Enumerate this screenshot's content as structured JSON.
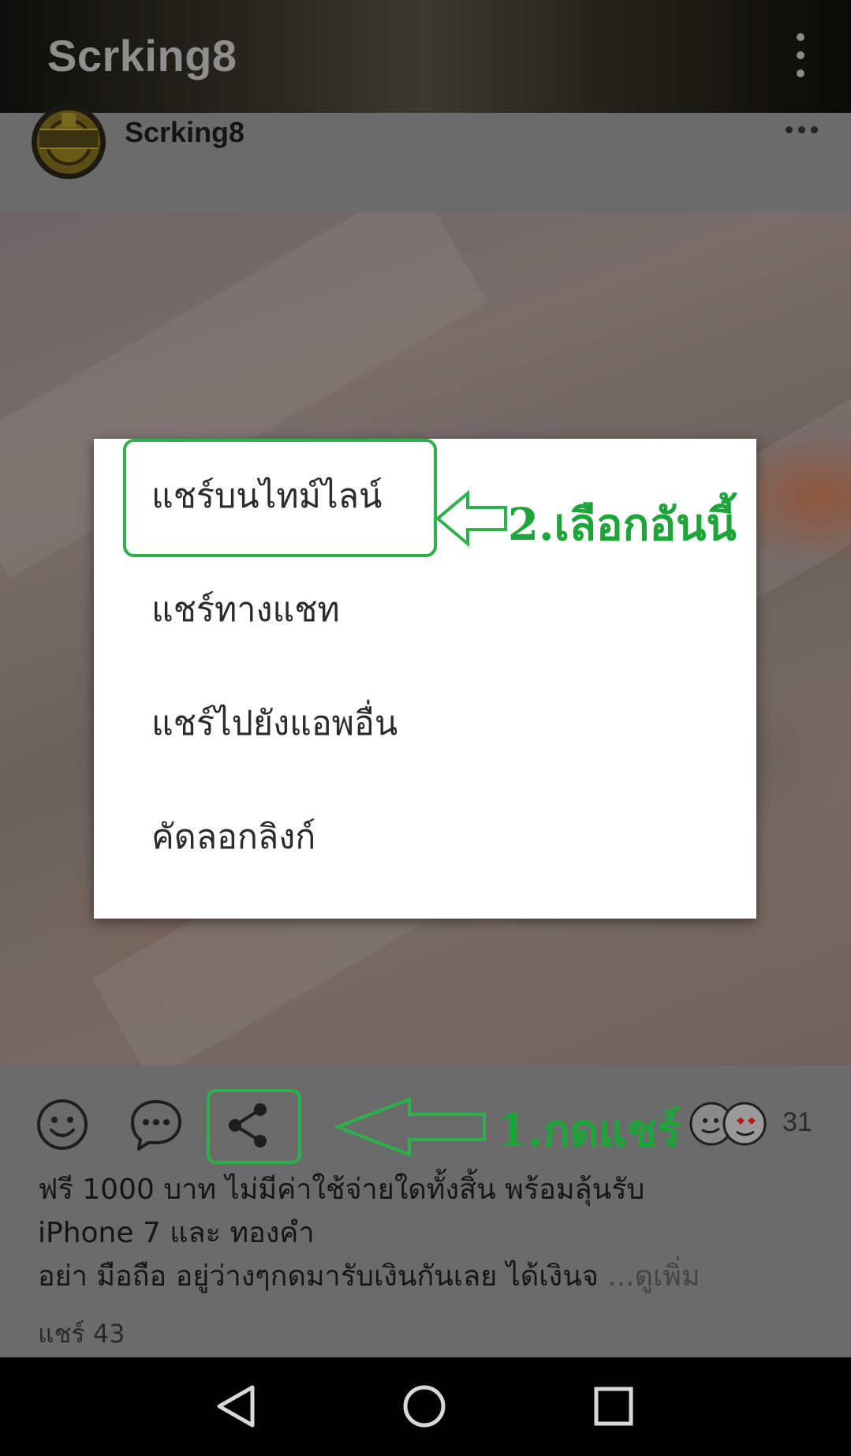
{
  "appbar": {
    "title": "Scrking8",
    "menu_icon": "overflow-menu-icon"
  },
  "post": {
    "author": "Scrking8",
    "more_icon": "more-horizontal-icon",
    "text_lines": [
      "ฟรี 1000 บาท ไม่มีค่าใช้จ่ายใดทั้งสิ้น พร้อมลุ้นรับ",
      "iPhone 7 และ ทองคำ",
      "อย่า มือถือ อยู่ว่างๆกดมารับเงินกันเลย ได้เงินจ"
    ],
    "see_more": "...ดูเพิ่ม",
    "share_count": "แชร์ 43",
    "reaction_count": "31"
  },
  "share_dialog": {
    "items": [
      "แชร์บนไทม์ไลน์",
      "แชร์ทางแชท",
      "แชร์ไปยังแอพอื่น",
      "คัดลอกลิงก์"
    ]
  },
  "annotations": {
    "step1": "1.กดแชร์",
    "step2": "2.เลือกอันนี้",
    "color": "#2cb24a"
  },
  "icons": [
    "smile-icon",
    "comment-icon",
    "share-icon",
    "reaction-stickers-icon",
    "back-icon",
    "home-icon",
    "recents-icon"
  ]
}
